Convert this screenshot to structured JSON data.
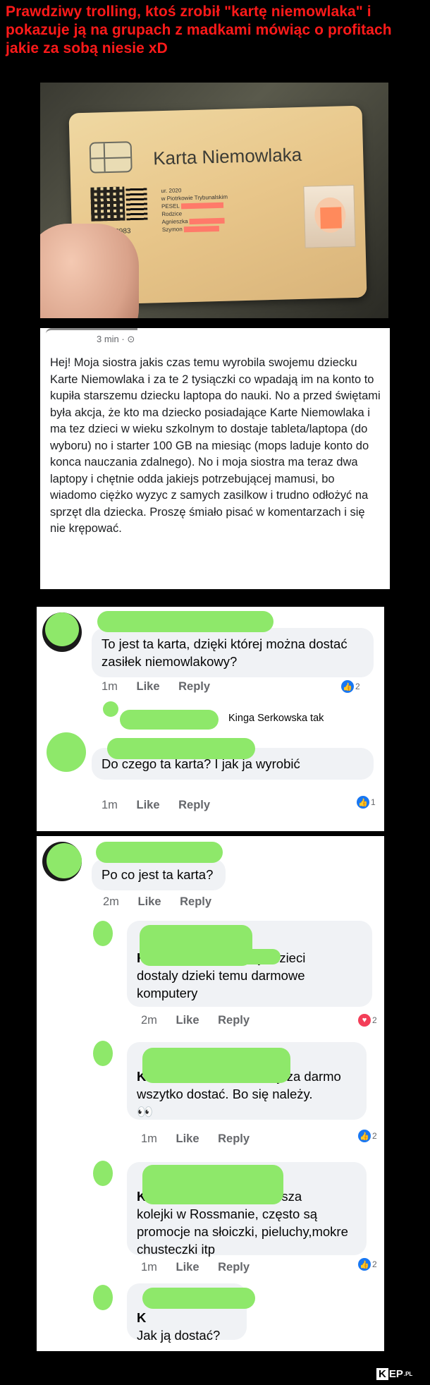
{
  "headline": "Prawdziwy trolling, ktoś zrobił \"kartę niemowlaka\" i pokazuje ją na grupach z madkami mówiąc o profitach jakie za sobą niesie xD",
  "card": {
    "title": "Karta Niemowlaka",
    "number": "0000010983",
    "fields": [
      "ur. 2020",
      "w Piotrkowie Trybunalskim",
      "PESEL",
      "Rodzice",
      "Agnieszka",
      "Szymon"
    ]
  },
  "post": {
    "meta": "3 min · ",
    "body": "Hej! Moja siostra jakis czas temu wyrobila swojemu dziecku Karte Niemowlaka i za te 2 tysiączki co wpadają im na konto to kupiła starszemu dziecku laptopa do nauki. No a przed świętami była akcja, że kto ma dziecko posiadające Karte Niemowlaka i ma tez dzieci w wieku szkolnym to dostaje tableta/laptopa (do wyboru) no i starter 100 GB na miesiąc (mops laduje konto do konca nauczania zdalnego). No i moja siostra ma teraz dwa laptopy i chętnie odda jakiejs potrzebującej mamusi, bo wiadomo ciężko wyzyc z samych zasilkow i trudno odłożyć na sprzęt dla dziecka. Proszę śmiało pisać w komentarzach i się nie krępować."
  },
  "panel1": {
    "c1": {
      "text": "To jest ta karta, dzięki której można dostać zasiłek niemowlakowy?",
      "time": "1m",
      "like": "Like",
      "reply": "Reply",
      "count": "2"
    },
    "reply_line": "Kinga Serkowska tak",
    "c2": {
      "text": "Do czego ta karta? I jak ja wyrobić",
      "time": "1m",
      "like": "Like",
      "reply": "Reply",
      "count": "1"
    }
  },
  "panel2": {
    "c1": {
      "text": "Po co jest ta karta?",
      "time": "2m",
      "like": "Like",
      "reply": "Reply"
    },
    "c2": {
      "lead": "Ka",
      "text_line1": "moje dzieci",
      "text_rest": "dostaly dzieki temu darmowe komputery",
      "time": "2m",
      "like": "Like",
      "reply": "Reply",
      "count": "2"
    },
    "c3": {
      "lead": "K",
      "text_line1": "zeby za darmo",
      "text_rest": "wszytko dostać. Bo się należy.",
      "emoji": "👀",
      "time": "1m",
      "like": "Like",
      "reply": "Reply",
      "count": "2"
    },
    "c4": {
      "lead": "Ka",
      "text_line1": "rzyspiesza",
      "text_rest": "kolejki w Rossmanie, często są promocje na słoiczki, pieluchy,mokre chusteczki itp",
      "time": "1m",
      "like": "Like",
      "reply": "Reply",
      "count": "2"
    },
    "c5": {
      "lead": "K",
      "text": "Jak ją dostać?"
    }
  },
  "watermark": {
    "k": "K",
    "rest": "EP",
    "tld": ".PL"
  },
  "colors": {
    "headline": "#ff1a1a",
    "highlight": "#8ee86a",
    "like_blue": "#1877f2",
    "heart_red": "#f33e58"
  }
}
